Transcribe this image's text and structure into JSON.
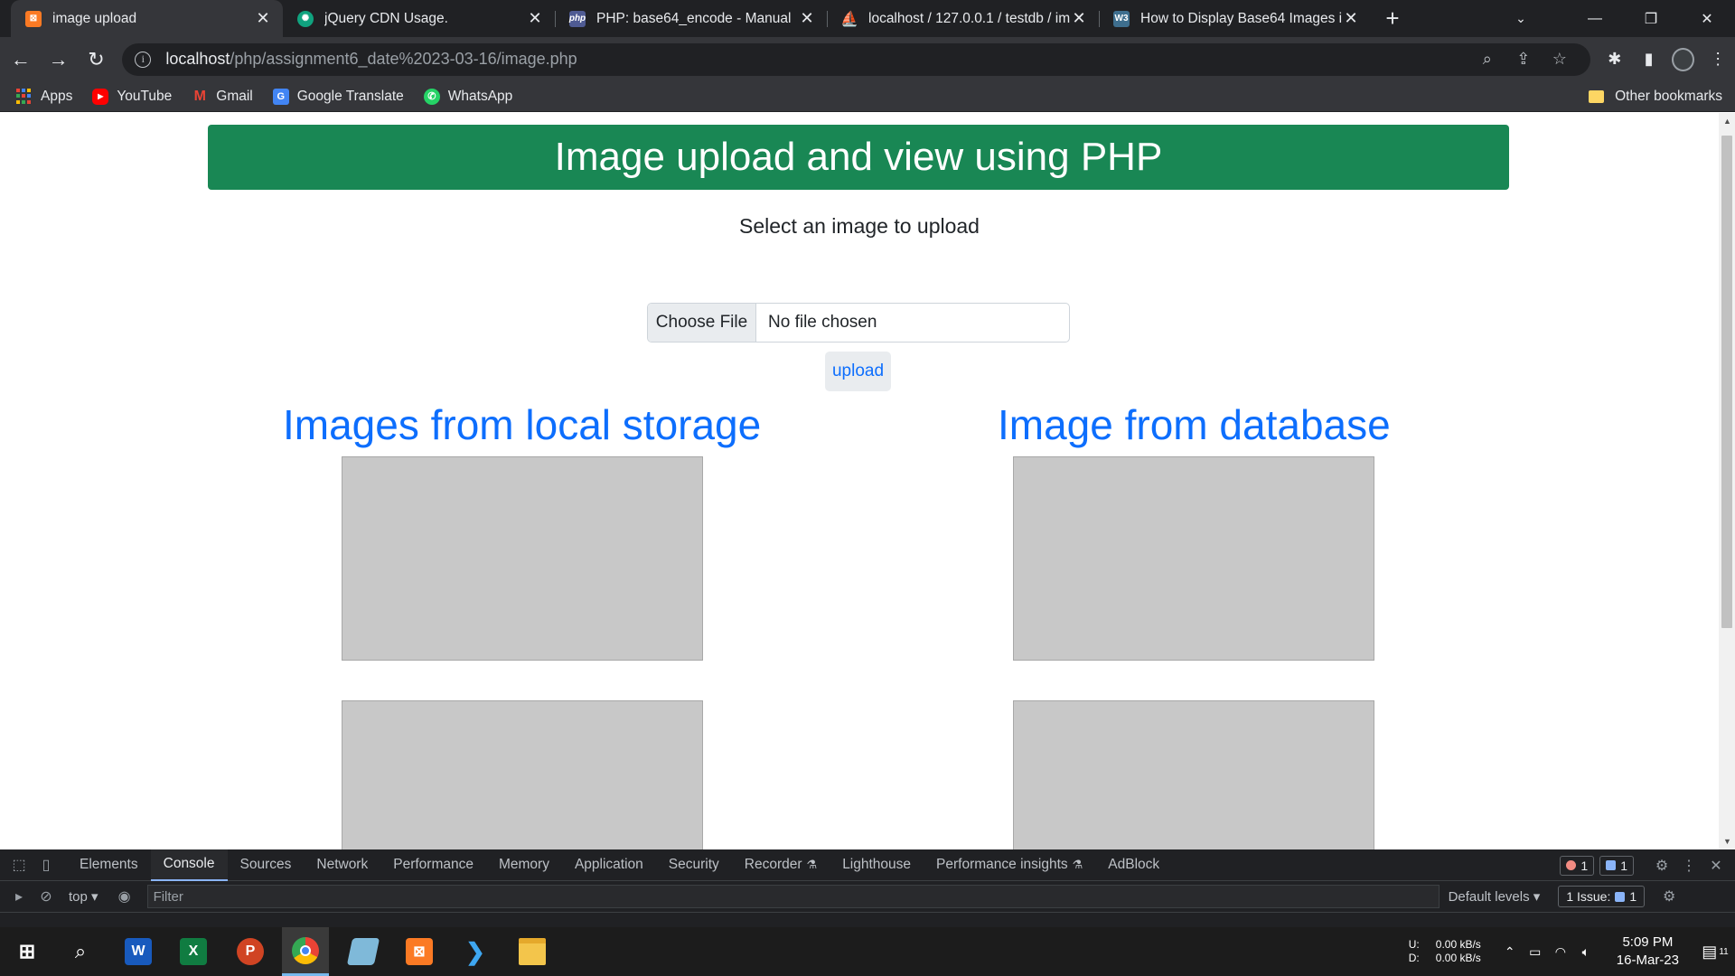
{
  "browser": {
    "tabs": [
      {
        "title": "image upload",
        "favicon": "xampp-icon",
        "color": "#fb7a24",
        "active": true
      },
      {
        "title": "jQuery CDN Usage.",
        "favicon": "chatgpt-icon",
        "color": "#10a37f",
        "active": false
      },
      {
        "title": "PHP: base64_encode - Manual",
        "favicon": "php-icon",
        "color": "#4f5b93",
        "active": false
      },
      {
        "title": "localhost / 127.0.0.1 / testdb / im",
        "favicon": "phpmyadmin-icon",
        "color": "#f89c0e",
        "active": false
      },
      {
        "title": "How to Display Base64 Images in",
        "favicon": "w3docs-icon",
        "color": "#3e6e8e",
        "active": false
      }
    ],
    "url_host": "localhost",
    "url_path": "/php/assignment6_date%2023-03-16/image.php"
  },
  "bookmarks": {
    "items": [
      {
        "label": "Apps",
        "icon": "apps-grid-icon"
      },
      {
        "label": "YouTube",
        "icon": "youtube-icon",
        "color": "#ff0000"
      },
      {
        "label": "Gmail",
        "icon": "gmail-icon",
        "color": "#ea4335"
      },
      {
        "label": "Google Translate",
        "icon": "google-translate-icon",
        "color": "#4285f4"
      },
      {
        "label": "WhatsApp",
        "icon": "whatsapp-icon",
        "color": "#25d366"
      }
    ],
    "other": "Other bookmarks"
  },
  "page": {
    "banner_title": "Image upload and view using PHP",
    "subtitle": "Select an image to upload",
    "choose_file_label": "Choose File",
    "no_file_text": "No file chosen",
    "upload_label": "upload",
    "local_heading": "Images from local storage",
    "db_heading": "Image from database"
  },
  "devtools": {
    "tabs": [
      "Elements",
      "Console",
      "Sources",
      "Network",
      "Performance",
      "Memory",
      "Application",
      "Security",
      "Recorder",
      "Lighthouse",
      "Performance insights",
      "AdBlock"
    ],
    "active_tab": "Console",
    "error_count": "1",
    "message_count": "1",
    "context": "top",
    "filter_placeholder": "Filter",
    "levels": "Default levels",
    "issues_label": "1 Issue:",
    "issues_count": "1"
  },
  "taskbar": {
    "apps": [
      "start-icon",
      "search-icon",
      "word-icon",
      "excel-icon",
      "powerpoint-icon",
      "chrome-icon",
      "notepad-icon",
      "xampp-icon",
      "vscode-icon",
      "file-explorer-icon"
    ],
    "net_up_label": "U:",
    "net_down_label": "D:",
    "net_up": "0.00 kB/s",
    "net_down": "0.00 kB/s",
    "time": "5:09 PM",
    "date": "16-Mar-23",
    "notification_count": "11"
  },
  "colors": {
    "banner_bg": "#198754",
    "heading_blue": "#0d6efd",
    "chrome_dark": "#202124",
    "chrome_toolbar": "#35363a"
  }
}
